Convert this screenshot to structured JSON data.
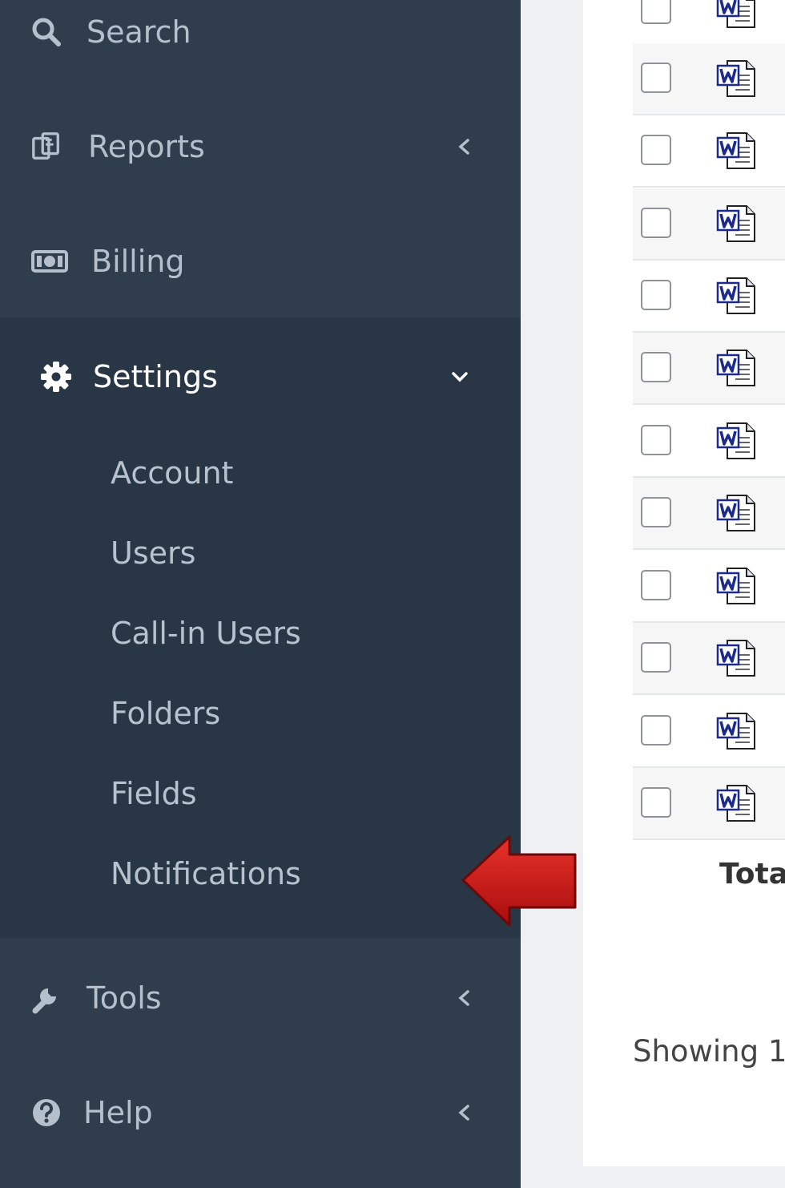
{
  "sidebar": {
    "items": [
      {
        "label": "Search",
        "icon": "search-icon"
      },
      {
        "label": "Reports",
        "icon": "reports-icon"
      },
      {
        "label": "Billing",
        "icon": "billing-icon"
      }
    ],
    "settings": {
      "label": "Settings",
      "icon": "gear-icon",
      "expanded": true,
      "subitems": [
        "Account",
        "Users",
        "Call-in Users",
        "Folders",
        "Fields",
        "Notifications"
      ]
    },
    "bottom_items": [
      {
        "label": "Tools",
        "icon": "wrench-icon"
      },
      {
        "label": "Help",
        "icon": "help-icon"
      }
    ]
  },
  "main": {
    "row_icon": "word-document-icon",
    "total_label": "Tota",
    "showing_text": "Showing 1"
  },
  "colors": {
    "sidebar_bg": "#2f3d4d",
    "settings_bg": "#283646",
    "active_text": "#ffffff",
    "menu_text": "#b5c0cc",
    "arrow": "#d11a1a"
  }
}
